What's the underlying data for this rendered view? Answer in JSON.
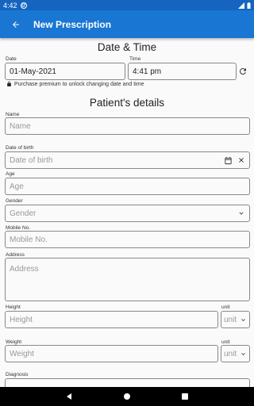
{
  "status_bar": {
    "time": "4:42"
  },
  "app_bar": {
    "title": "New Prescription"
  },
  "date_time": {
    "heading": "Date & Time",
    "date_label": "Date",
    "date_value": "01-May-2021",
    "time_label": "Time",
    "time_value": "4:41 pm",
    "premium_note": "Purchase premium to unlock changing date and time"
  },
  "patient": {
    "heading": "Patient's details",
    "name_label": "Name",
    "name_placeholder": "Name",
    "dob_label": "Date of birth",
    "dob_placeholder": "Date of birth",
    "age_label": "Age",
    "age_placeholder": "Age",
    "gender_label": "Gender",
    "gender_placeholder": "Gender",
    "mobile_label": "Mobile No.",
    "mobile_placeholder": "Mobile No.",
    "address_label": "Address",
    "address_placeholder": "Address",
    "height_label": "Height",
    "height_placeholder": "Height",
    "height_unit_label": "unit",
    "height_unit_placeholder": "unit",
    "weight_label": "Weight",
    "weight_placeholder": "Weight",
    "weight_unit_label": "unit",
    "weight_unit_placeholder": "unit",
    "diagnosis_label": "Diagnosis"
  },
  "colors": {
    "status_bar": "#1565c0",
    "app_bar": "#1976d2"
  }
}
